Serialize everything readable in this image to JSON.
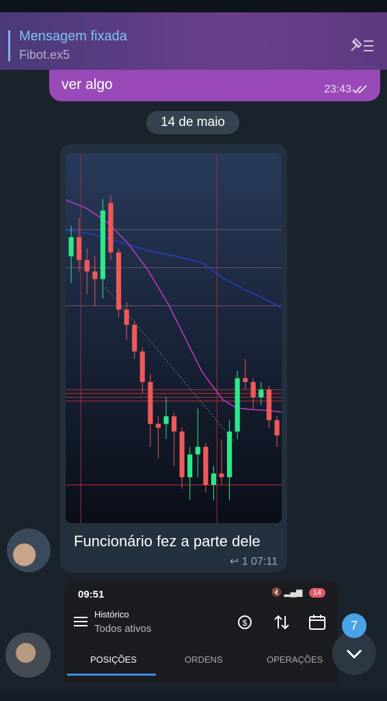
{
  "pinned": {
    "title": "Mensagem fixada",
    "subtitle": "Fibot.ex5"
  },
  "outgoing": {
    "text": "ver algo",
    "time": "23:43"
  },
  "date_separator": "14 de maio",
  "photo_message": {
    "caption": "Funcionário fez a parte dele",
    "replies": "1",
    "time": "07:11"
  },
  "phone": {
    "clock": "09:51",
    "battery": "14",
    "header_label": "Histórico",
    "header_value": "Todos ativos",
    "tabs": [
      "POSIÇÕES",
      "ORDENS",
      "OPERAÇÕES"
    ]
  },
  "unread_badge": "7",
  "colors": {
    "up": "#2ee88a",
    "down": "#ee5a5a",
    "pinned_bg": "#5c3a80",
    "bubble_out": "#9a4ab8"
  },
  "chart_data": {
    "type": "candlestick",
    "candles": [
      {
        "o": 0.28,
        "c": 0.33,
        "h": 0.36,
        "l": 0.21,
        "up": true
      },
      {
        "o": 0.33,
        "c": 0.27,
        "h": 0.38,
        "l": 0.24,
        "up": false
      },
      {
        "o": 0.27,
        "c": 0.24,
        "h": 0.3,
        "l": 0.18,
        "up": false
      },
      {
        "o": 0.24,
        "c": 0.22,
        "h": 0.28,
        "l": 0.15,
        "up": false
      },
      {
        "o": 0.22,
        "c": 0.4,
        "h": 0.43,
        "l": 0.17,
        "up": true
      },
      {
        "o": 0.42,
        "c": 0.29,
        "h": 0.44,
        "l": 0.27,
        "up": false
      },
      {
        "o": 0.29,
        "c": 0.14,
        "h": 0.3,
        "l": 0.12,
        "up": false
      },
      {
        "o": 0.14,
        "c": 0.1,
        "h": 0.16,
        "l": 0.06,
        "up": false
      },
      {
        "o": 0.1,
        "c": 0.03,
        "h": 0.11,
        "l": 0.01,
        "up": false
      },
      {
        "o": 0.03,
        "c": -0.05,
        "h": 0.04,
        "l": -0.08,
        "up": false
      },
      {
        "o": -0.05,
        "c": -0.16,
        "h": -0.03,
        "l": -0.22,
        "up": false
      },
      {
        "o": -0.16,
        "c": -0.17,
        "h": -0.14,
        "l": -0.25,
        "up": false
      },
      {
        "o": -0.16,
        "c": -0.14,
        "h": -0.09,
        "l": -0.2,
        "up": true
      },
      {
        "o": -0.14,
        "c": -0.18,
        "h": -0.13,
        "l": -0.27,
        "up": false
      },
      {
        "o": -0.18,
        "c": -0.3,
        "h": -0.17,
        "l": -0.33,
        "up": false
      },
      {
        "o": -0.3,
        "c": -0.24,
        "h": -0.22,
        "l": -0.36,
        "up": true
      },
      {
        "o": -0.24,
        "c": -0.22,
        "h": -0.12,
        "l": -0.3,
        "up": true
      },
      {
        "o": -0.22,
        "c": -0.32,
        "h": -0.21,
        "l": -0.34,
        "up": false
      },
      {
        "o": -0.32,
        "c": -0.29,
        "h": -0.27,
        "l": -0.36,
        "up": true
      },
      {
        "o": -0.29,
        "c": -0.3,
        "h": -0.2,
        "l": -0.32,
        "up": false
      },
      {
        "o": -0.3,
        "c": -0.18,
        "h": -0.15,
        "l": -0.36,
        "up": true
      },
      {
        "o": -0.18,
        "c": -0.04,
        "h": -0.02,
        "l": -0.2,
        "up": true
      },
      {
        "o": -0.04,
        "c": -0.05,
        "h": 0.01,
        "l": -0.07,
        "up": false
      },
      {
        "o": -0.05,
        "c": -0.09,
        "h": -0.04,
        "l": -0.12,
        "up": false
      },
      {
        "o": -0.09,
        "c": -0.07,
        "h": -0.05,
        "l": -0.11,
        "up": true
      },
      {
        "o": -0.07,
        "c": -0.15,
        "h": -0.06,
        "l": -0.17,
        "up": false
      },
      {
        "o": -0.15,
        "c": -0.19,
        "h": -0.14,
        "l": -0.22,
        "up": false
      }
    ],
    "hlines": [
      0.35,
      0.25,
      0.15,
      -0.07,
      -0.08,
      -0.09,
      -0.1,
      -0.32
    ],
    "vlines": [
      0.07,
      0.7
    ]
  }
}
